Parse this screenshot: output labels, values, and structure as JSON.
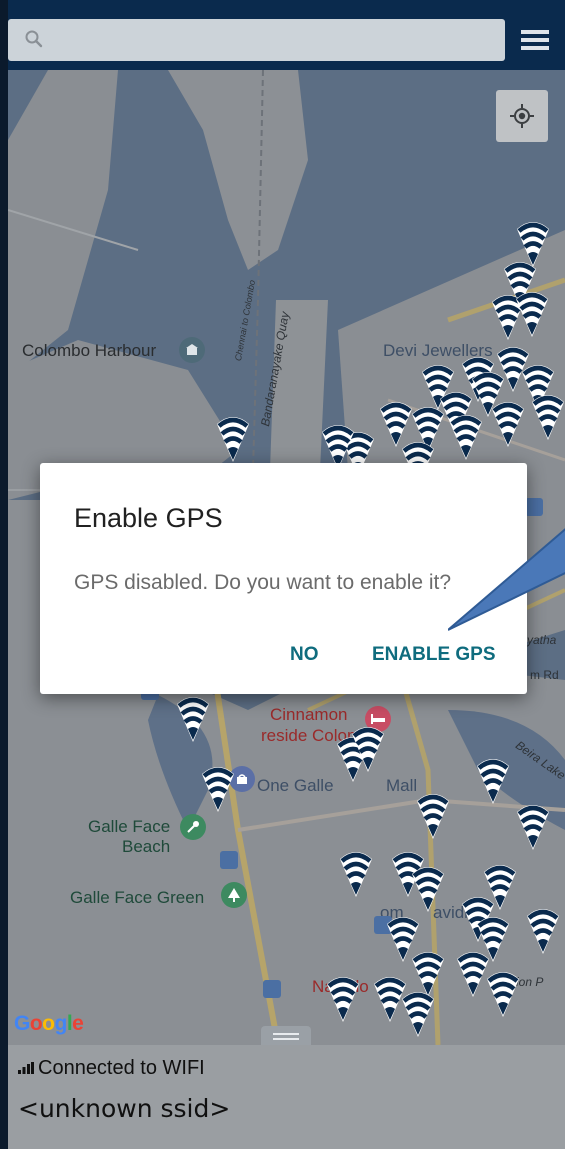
{
  "search": {
    "placeholder": ""
  },
  "icons": {
    "search": "search-icon",
    "menu": "menu-icon",
    "locate": "my-location-icon",
    "wifi_pin": "wifi-hotspot-icon"
  },
  "map": {
    "labels": {
      "colombo_harbour": "Colombo Harbour",
      "chennai_to_colombo": "Chennai to Colombo",
      "bandaranayake_quay": "Bandaranayake Quay",
      "devi_jewellers": "Devi Jewellers",
      "cinnamon": "Cinnamon",
      "cinnamon_sub": "reside Colombo",
      "one_galle": "One Galle",
      "mall": "Mall",
      "galle_face_beach_1": "Galle Face",
      "galle_face_beach_2": "Beach",
      "galle_face_green": "Galle Face Green",
      "beira_lake": "Beira Lake",
      "nawala": "Nawalo",
      "vidiya": "avidiya",
      "yatha": "yatha",
      "m_rd": "m Rd",
      "om": "om",
      "ion": "ion P"
    },
    "google": "Google",
    "google_colors": [
      "#4285F4",
      "#EA4335",
      "#FBBC05",
      "#4285F4",
      "#34A853",
      "#EA4335"
    ]
  },
  "dialog": {
    "title": "Enable GPS",
    "message": "GPS disabled. Do you want to enable it?",
    "no_label": "NO",
    "enable_label": "ENABLE GPS"
  },
  "status": {
    "connection": "Connected to WIFI",
    "ssid": "<unknown ssid>"
  },
  "colors": {
    "topbar": "#0a2a4d",
    "accent": "#0f6c7e",
    "pin": "#0a2a4d",
    "callout": "#4a78b8"
  }
}
